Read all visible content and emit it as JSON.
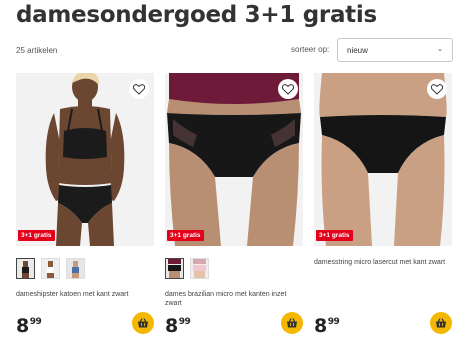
{
  "page": {
    "title": "damesondergoed 3+1 gratis",
    "count": "25 artikelen",
    "sort_label": "sorteer op:",
    "sort_value": "nieuw"
  },
  "colors": {
    "badge": "#e3001b",
    "cart_button": "#f5b800"
  },
  "icons": {
    "wishlist": "heart-outline-icon",
    "cart": "shopping-basket-icon",
    "sort": "chevron-down-icon"
  },
  "products": [
    {
      "badge": "3+1 gratis",
      "name": "dameshipster katoen met kant zwart",
      "price_euros": "8",
      "price_cents": "99",
      "swatches": [
        "zwart",
        "wit",
        "blauw"
      ]
    },
    {
      "badge": "3+1 gratis",
      "name": "dames brazilian micro met kanten inzet zwart",
      "price_euros": "8",
      "price_cents": "99",
      "swatches": [
        "zwart",
        "roze"
      ]
    },
    {
      "badge": "3+1 gratis",
      "name": "damesstring micro lasercut met kant zwart",
      "price_euros": "8",
      "price_cents": "99",
      "swatches": []
    }
  ]
}
